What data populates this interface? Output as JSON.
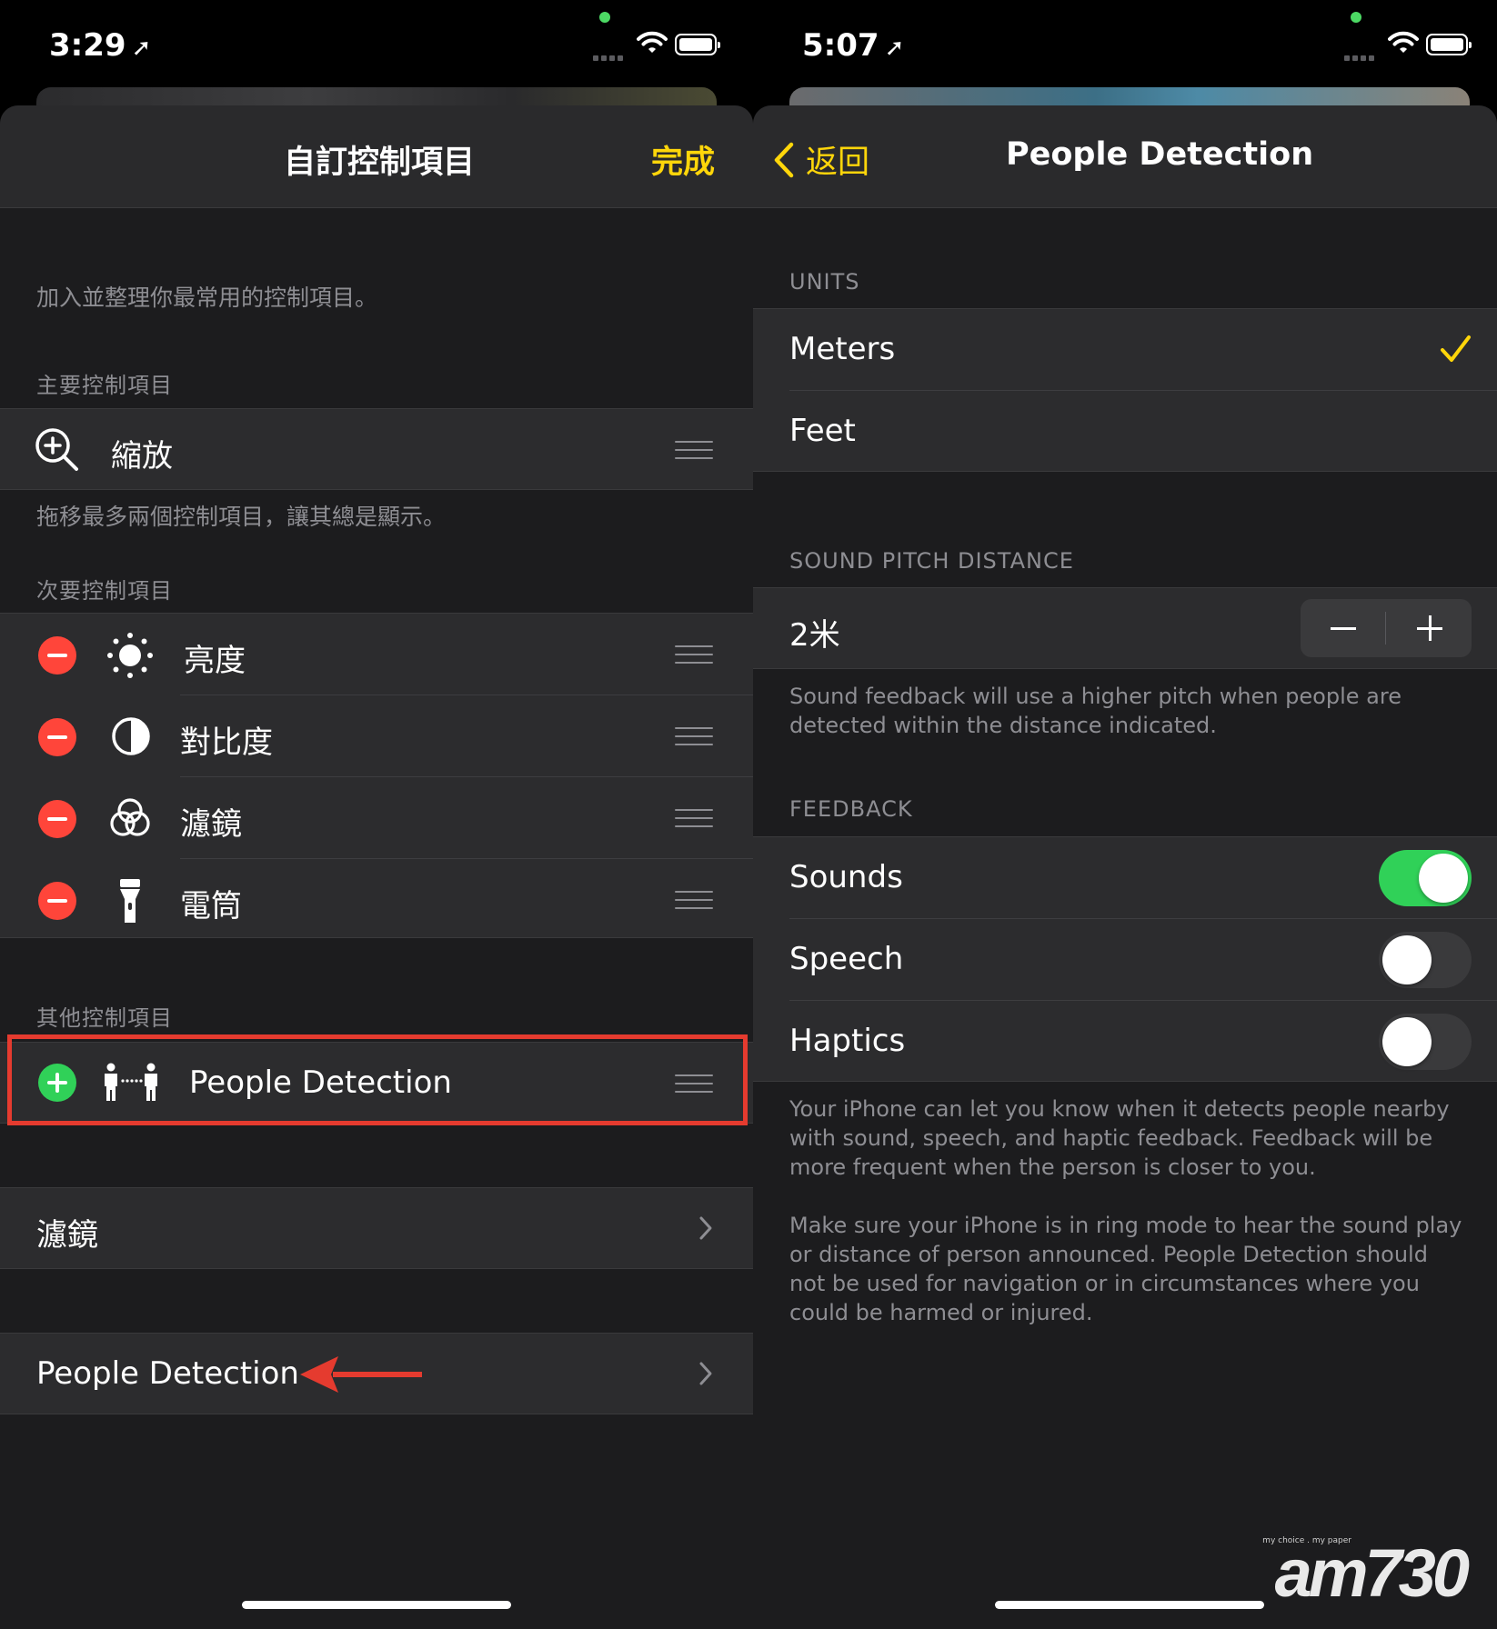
{
  "left": {
    "status": {
      "time": "3:29"
    },
    "nav": {
      "title": "自訂控制項目",
      "done": "完成"
    },
    "intro": "加入並整理你最常用的控制項目。",
    "primary": {
      "header": "主要控制項目",
      "items": [
        {
          "label": "縮放",
          "icon": "zoom-icon"
        }
      ]
    },
    "primary_footer": "拖移最多兩個控制項目，讓其總是顯示。",
    "secondary": {
      "header": "次要控制項目",
      "items": [
        {
          "label": "亮度",
          "icon": "brightness-icon"
        },
        {
          "label": "對比度",
          "icon": "contrast-icon"
        },
        {
          "label": "濾鏡",
          "icon": "filters-icon"
        },
        {
          "label": "電筒",
          "icon": "flashlight-icon"
        }
      ]
    },
    "other": {
      "header": "其他控制項目",
      "items": [
        {
          "label": "People Detection",
          "icon": "people-detection-icon"
        }
      ]
    },
    "links": [
      {
        "label": "濾鏡"
      },
      {
        "label": "People Detection"
      }
    ],
    "annotation_color": "#e53b2f"
  },
  "right": {
    "status": {
      "time": "5:07"
    },
    "nav": {
      "back": "返回",
      "title": "People Detection"
    },
    "units": {
      "header": "UNITS",
      "options": [
        {
          "label": "Meters",
          "selected": true
        },
        {
          "label": "Feet",
          "selected": false
        }
      ]
    },
    "pitch": {
      "header": "SOUND PITCH DISTANCE",
      "value": "2米",
      "footer": "Sound feedback will use a higher pitch when people are detected within the distance indicated."
    },
    "feedback": {
      "header": "FEEDBACK",
      "items": [
        {
          "label": "Sounds",
          "on": true
        },
        {
          "label": "Speech",
          "on": false
        },
        {
          "label": "Haptics",
          "on": false
        }
      ],
      "footer1": "Your iPhone can let you know when it detects people nearby with sound, speech, and haptic feedback. Feedback will be more frequent when the person is closer to you.",
      "footer2": "Make sure your iPhone is in ring mode to hear the sound play or distance of person announced. People Detection should not be used for navigation or in circumstances where you could be harmed or injured."
    }
  },
  "watermark": {
    "tagline": "my choice . my paper",
    "logo": "am730"
  },
  "colors": {
    "accent": "#ffd60a",
    "toggle_on": "#30d158",
    "delete": "#ff453a",
    "add": "#30d158",
    "background": "#1c1c1e",
    "row": "#2c2c2e"
  }
}
